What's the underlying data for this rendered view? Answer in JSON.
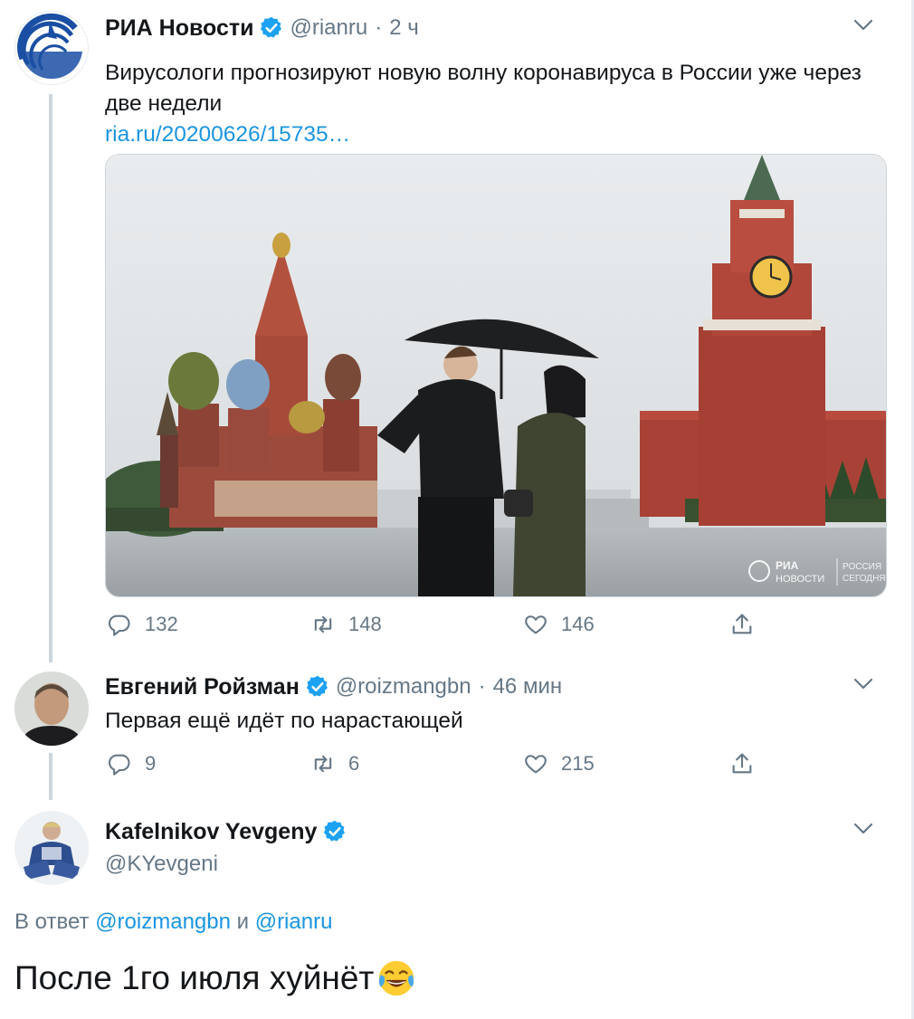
{
  "tweet1": {
    "name": "РИА Новости",
    "handle": "@rianru",
    "dot": "·",
    "time": "2 ч",
    "text": "Вирусологи прогнозируют новую волну коронавируса в России уже через две недели",
    "link": "ria.ru/20200626/15735…",
    "replies": "132",
    "retweets": "148",
    "likes": "146",
    "watermark_line1": "РИА",
    "watermark_line2": "НОВОСТИ",
    "watermark_line3": "РОССИЯ",
    "watermark_line4": "СЕГОДНЯ"
  },
  "tweet2": {
    "name": "Евгений Ройзман",
    "handle": "@roizmangbn",
    "dot": "·",
    "time": "46 мин",
    "text": "Первая ещё идёт по нарастающей",
    "replies": "9",
    "retweets": "6",
    "likes": "215"
  },
  "tweet3": {
    "name": "Kafelnikov Yevgeny",
    "handle": "@KYevgeni",
    "reply_prefix": "В ответ",
    "reply_mention1": "@roizmangbn",
    "reply_and": "и",
    "reply_mention2": "@rianru",
    "text": "После 1го июля хуйнёт"
  },
  "icons": {
    "verified": "verified-badge-icon",
    "caret": "chevron-down-icon",
    "reply": "reply-icon",
    "retweet": "retweet-icon",
    "like": "heart-icon",
    "share": "share-icon",
    "emoji": "face-with-tears-of-joy-emoji"
  },
  "colors": {
    "accent": "#1da1f2",
    "link": "#1b95e0",
    "muted": "#657786",
    "thread_line": "#ccd6dd"
  }
}
